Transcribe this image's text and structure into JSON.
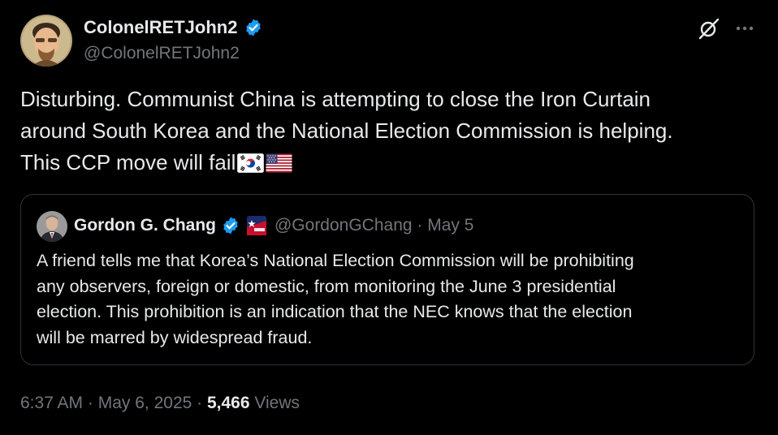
{
  "tweet": {
    "author": {
      "display_name": "ColonelRETJohn2",
      "handle": "@ColonelRETJohn2",
      "verified": true,
      "verified_icon": "verified-badge-icon"
    },
    "text_lines": [
      "Disturbing.  Communist China is attempting to close the Iron Curtain",
      "around South Korea and the National Election Commission is helping.",
      "This CCP move will fail"
    ],
    "emoji": [
      "south-korea-flag-icon",
      "us-flag-icon"
    ],
    "header_icons": [
      "grok-icon",
      "more-icon"
    ],
    "quoted": {
      "display_name": "Gordon G. Chang",
      "verified": true,
      "affiliate_badge": "cpac-badge-icon",
      "handle": "@GordonGChang",
      "separator": " · ",
      "date": "May 5",
      "text_lines": [
        "A friend tells me that Korea’s National Election Commission will be prohibiting",
        "any observers, foreign or domestic, from monitoring the June 3 presidential",
        "election. This prohibition is an indication that the NEC knows that the election",
        "will be marred by widespread fraud."
      ]
    },
    "footer": {
      "time": "6:37 AM",
      "separator": " · ",
      "date": "May 6, 2025",
      "views_count": "5,466",
      "views_label": "Views"
    }
  },
  "colors": {
    "background": "#000000",
    "text_primary": "#e7e9ea",
    "text_secondary": "#71767b",
    "border": "#2f3336",
    "verified_blue": "#1d9bf0"
  }
}
